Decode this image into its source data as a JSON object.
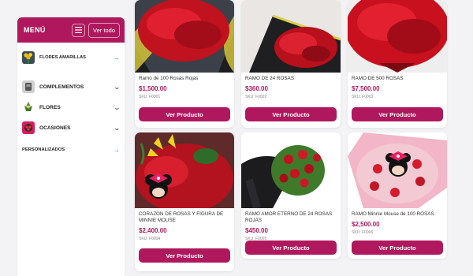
{
  "sidebar": {
    "title": "MENÚ",
    "menu_icon": "hamburger-icon",
    "ver_todo": "Ver todo",
    "items": [
      {
        "label": "FLORES AMARILLAS",
        "action": "arrow-right-icon"
      },
      {
        "label": "COMPLEMENTOS",
        "action": "chevron-down-icon"
      },
      {
        "label": "FLORES",
        "action": "chevron-down-icon"
      },
      {
        "label": "OCASIONES",
        "action": "chevron-down-icon"
      },
      {
        "label": "PERSONALIZADOS",
        "action": "arrow-right-icon"
      }
    ]
  },
  "products": [
    {
      "name": "Ramo de 100 Rosas Rojas",
      "price": "$1,500.00",
      "sku": "SKU: F0001",
      "button": "Ver Producto"
    },
    {
      "name": "RAMO DE 24 ROSAS",
      "price": "$360.00",
      "sku": "SKU: F0002",
      "button": "Ver Producto"
    },
    {
      "name": "RAMO DE 500 ROSAS",
      "price": "$7,500.00",
      "sku": "SKU: F0003",
      "button": "Ver Producto"
    },
    {
      "name": "CORAZON DE ROSAS Y FIGURA DE MINNIE MOUSE",
      "price": "$2,400.00",
      "sku": "SKU: F0004",
      "button": "Ver Producto"
    },
    {
      "name": "RAMO AMOR ETERNO DE 24 ROSAS ROJAS",
      "price": "$450.00",
      "sku": "SKU: F0005",
      "button": "Ver Producto"
    },
    {
      "name": "RAMO Minnie Mouse de 100 ROSAS",
      "price": "$2,500.00",
      "sku": "SKU: F0006",
      "button": "Ver Producto"
    }
  ],
  "colors": {
    "brand": "#b0185e",
    "link": "#1e7ad8"
  }
}
